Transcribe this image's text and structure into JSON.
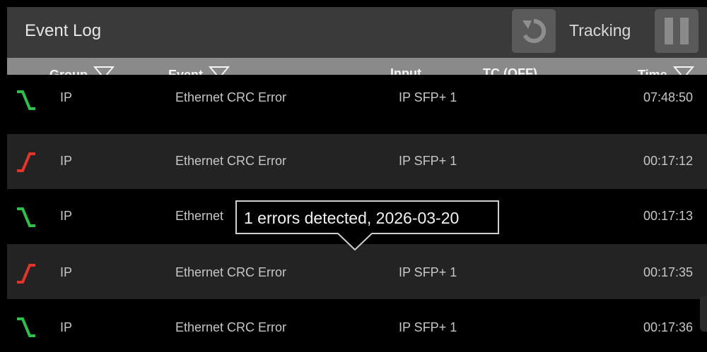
{
  "app": {
    "title": "Event Log",
    "tracking_label": "Tracking",
    "undo_icon": "undo-icon",
    "pause_icon": "pause-icon"
  },
  "columns": {
    "group": "Group",
    "event": "Event",
    "input": "Input",
    "tc": "TC (OFF)",
    "time": "Time"
  },
  "rows": [
    {
      "edge": "falling",
      "group": "IP",
      "event": "Ethernet CRC Error",
      "input": "IP SFP+ 1",
      "time": "07:48:50"
    },
    {
      "edge": "rising",
      "group": "IP",
      "event": "Ethernet CRC Error",
      "input": "IP SFP+ 1",
      "time": "00:17:12"
    },
    {
      "edge": "falling",
      "group": "IP",
      "event": "Ethernet",
      "input": "",
      "time": "00:17:13"
    },
    {
      "edge": "rising",
      "group": "IP",
      "event": "Ethernet CRC Error",
      "input": "IP SFP+ 1",
      "time": "00:17:35"
    },
    {
      "edge": "falling",
      "group": "IP",
      "event": "Ethernet CRC Error",
      "input": "IP SFP+ 1",
      "time": "00:17:36"
    }
  ],
  "tooltip": {
    "text": "1 errors detected, 2026-03-20"
  },
  "colors": {
    "falling_edge": "#2fbf4a",
    "rising_edge": "#e0352b",
    "header_bg": "#8a8a8a",
    "titlebar_bg": "#3a3a3a"
  }
}
